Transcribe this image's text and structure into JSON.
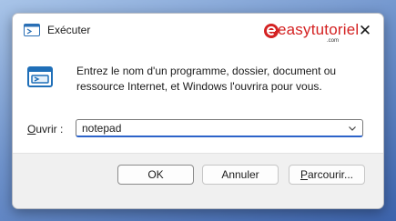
{
  "window": {
    "title": "Exécuter",
    "close_glyph": "✕"
  },
  "brand": {
    "name": "easytutoriel",
    "sub": ".com"
  },
  "content": {
    "description": "Entrez le nom d'un programme, dossier, document ou ressource Internet, et Windows l'ouvrira pour vous."
  },
  "open": {
    "label_prefix": "O",
    "label_rest": "uvrir :",
    "value": "notepad"
  },
  "buttons": {
    "ok": "OK",
    "cancel": "Annuler",
    "browse_prefix": "P",
    "browse_rest": "arcourir..."
  },
  "icons": {
    "title": "run-icon",
    "main": "run-icon",
    "close": "close-icon",
    "dropdown": "chevron-down-icon",
    "brand": "easytutoriel-logo"
  },
  "colors": {
    "accent": "#2c63c9",
    "brand": "#d42222"
  }
}
